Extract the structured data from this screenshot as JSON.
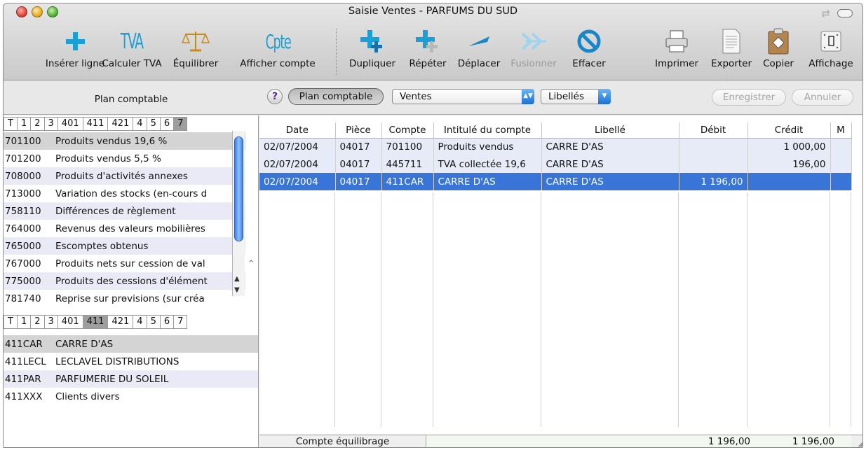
{
  "window": {
    "title": "Saisie Ventes - PARFUMS DU SUD"
  },
  "toolbar": [
    {
      "label": "Insérer ligne",
      "icon": "plus-icon"
    },
    {
      "label": "Calculer TVA",
      "icon": "tva-icon",
      "text": "TVA"
    },
    {
      "label": "Équilibrer",
      "icon": "balance-icon"
    },
    {
      "label": "Afficher compte",
      "icon": "cpte-icon",
      "text": "Cpte"
    },
    {
      "label": "Dupliquer",
      "icon": "duplicate-icon"
    },
    {
      "label": "Répéter",
      "icon": "repeat-icon"
    },
    {
      "label": "Déplacer",
      "icon": "move-icon"
    },
    {
      "label": "Fusionner",
      "icon": "merge-icon",
      "disabled": true
    },
    {
      "label": "Effacer",
      "icon": "erase-icon"
    },
    {
      "label": "Imprimer",
      "icon": "printer-icon"
    },
    {
      "label": "Exporter",
      "icon": "export-icon"
    },
    {
      "label": "Copier",
      "icon": "copy-icon"
    },
    {
      "label": "Affichage",
      "icon": "display-icon"
    }
  ],
  "band": {
    "plan_title": "Plan comptable",
    "help": "?",
    "plan_button": "Plan comptable",
    "journal_select": "Ventes",
    "libelles_select": "Libellés",
    "save_button": "Enregistrer",
    "cancel_button": "Annuler"
  },
  "tabs_top": [
    "T",
    "1",
    "2",
    "3",
    "401",
    "411",
    "421",
    "4",
    "5",
    "6",
    "7"
  ],
  "tabs_bottom": [
    "T",
    "1",
    "2",
    "3",
    "401",
    "411",
    "421",
    "4",
    "5",
    "6",
    "7"
  ],
  "accounts_top": [
    {
      "code": "701100",
      "name": "Produits vendus 19,6 %"
    },
    {
      "code": "701200",
      "name": "Produits vendus 5,5 %"
    },
    {
      "code": "708000",
      "name": "Produits d'activités annexes"
    },
    {
      "code": "713000",
      "name": "Variation des stocks (en-cours d"
    },
    {
      "code": "758110",
      "name": "Différences de règlement"
    },
    {
      "code": "764000",
      "name": "Revenus des valeurs mobilières"
    },
    {
      "code": "765000",
      "name": "Escomptes obtenus"
    },
    {
      "code": "767000",
      "name": "Produits nets sur cession de val"
    },
    {
      "code": "775000",
      "name": "Produits des cessions d'élément"
    },
    {
      "code": "781740",
      "name": "Reprise sur provisions (sur créa"
    }
  ],
  "accounts_bottom": [
    {
      "code": "411CAR",
      "name": "CARRE D'AS"
    },
    {
      "code": "411LECL",
      "name": "LECLAVEL DISTRIBUTIONS"
    },
    {
      "code": "411PAR",
      "name": "PARFUMERIE DU SOLEIL"
    },
    {
      "code": "411XXX",
      "name": "Clients divers"
    }
  ],
  "grid": {
    "headers": [
      "Date",
      "Pièce",
      "Compte",
      "Intitulé du compte",
      "Libellé",
      "Débit",
      "Crédit",
      "M"
    ],
    "rows": [
      {
        "date": "02/07/2004",
        "piece": "04017",
        "compte": "701100",
        "intitule": "Produits vendus",
        "libelle": "CARRE D'AS",
        "debit": "",
        "credit": "1 000,00",
        "m": ""
      },
      {
        "date": "02/07/2004",
        "piece": "04017",
        "compte": "445711",
        "intitule": "TVA collectée 19,6",
        "libelle": "CARRE D'AS",
        "debit": "",
        "credit": "196,00",
        "m": ""
      },
      {
        "date": "02/07/2004",
        "piece": "04017",
        "compte": "411CAR",
        "intitule": "CARRE D'AS",
        "libelle": "CARRE D'AS",
        "debit": "1 196,00",
        "credit": "",
        "m": ""
      }
    ]
  },
  "footer": {
    "label": "Compte équilibrage",
    "debit": "1 196,00",
    "credit": "1 196,00"
  },
  "colors": {
    "selection": "#3875d7",
    "accent_blue": "#1aa0d6",
    "row_alt": "#eaeaf6"
  }
}
